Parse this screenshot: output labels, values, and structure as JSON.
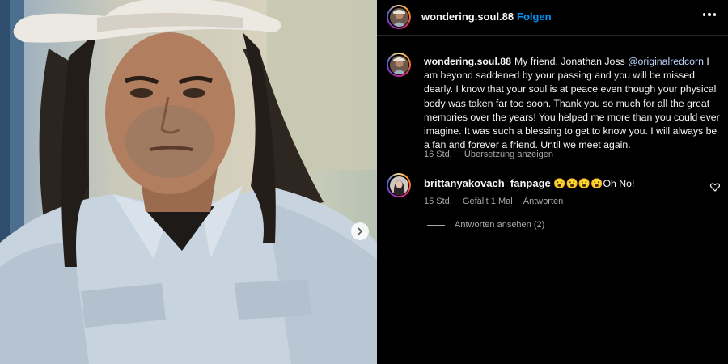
{
  "post": {
    "username": "wondering.soul.88",
    "separator": "•",
    "follow_label": "Folgen",
    "caption_username": "wondering.soul.88",
    "caption_part1": "My friend, Jonathan Joss ",
    "caption_mention": "@originalredcorn",
    "caption_part2": " I am beyond saddened by your passing and you will be missed dearly. I know that your soul is at peace even though your physical body was taken far too soon. Thank you so much for all the great memories over the years! You helped me more than you could ever imagine. It was such a blessing to get to know you. I will always be a fan and forever a friend. Until we meet again.",
    "caption_time": "16 Std.",
    "translate_label": "Übersetzung anzeigen"
  },
  "comment": {
    "username": "brittanyakovach_fanpage",
    "emojis": "😮😮😮😮",
    "text": "Oh No!",
    "time": "15 Std.",
    "likes": "Gefällt 1 Mal",
    "reply_label": "Antworten",
    "view_replies_label": "Antworten ansehen (2)"
  },
  "icons": {
    "more": "more-options-icon",
    "heart": "heart-icon",
    "next": "chevron-right-icon"
  },
  "colors": {
    "background": "#000000",
    "follow": "#0095f6",
    "secondary_text": "#a8a8a8"
  }
}
